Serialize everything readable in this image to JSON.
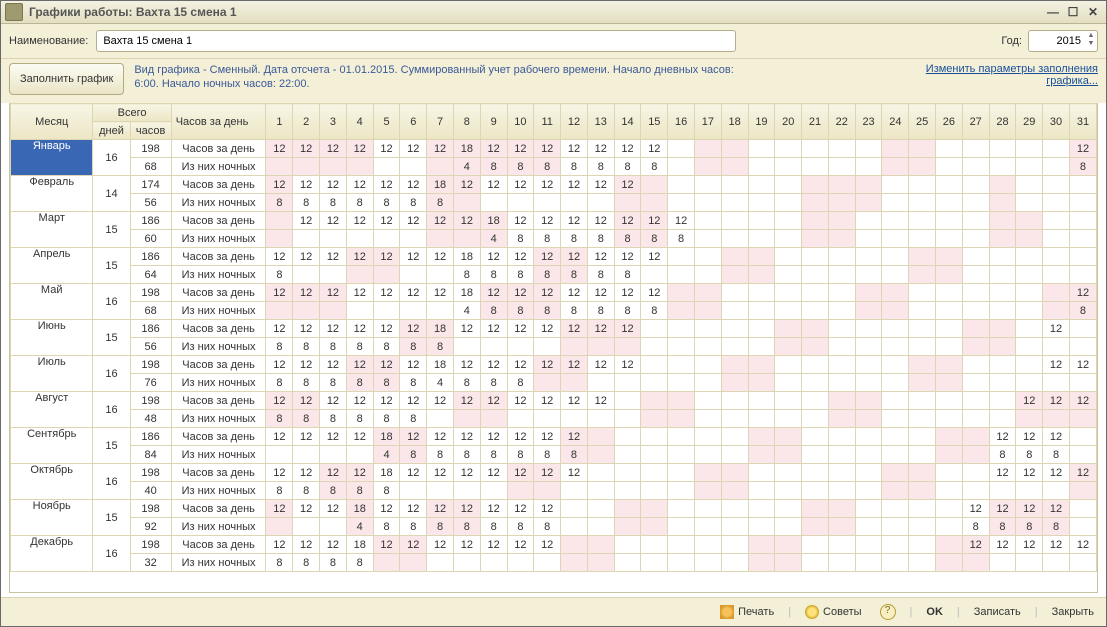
{
  "window": {
    "title": "Графики работы: Вахта 15 смена 1"
  },
  "toolbar": {
    "name_label": "Наименование:",
    "name_value": "Вахта 15 смена 1",
    "year_label": "Год:",
    "year_value": "2015",
    "fill_button": "Заполнить график",
    "description_line1": "Вид графика - Сменный. Дата отсчета - 01.01.2015. Суммированный учет рабочего времени. Начало дневных часов:",
    "description_line2": "6:00. Начало ночных часов: 22:00.",
    "link_line1": "Изменить параметры заполнения",
    "link_line2": "графика..."
  },
  "headers": {
    "month": "Месяц",
    "total": "Всего",
    "days": "дней",
    "hours": "часов",
    "perday": "Часов за день"
  },
  "row_labels": {
    "hours": "Часов за день",
    "night": "Из них ночных"
  },
  "weekend_days": {
    "0": [
      1,
      2,
      3,
      4,
      7,
      8,
      9,
      10,
      11,
      17,
      18,
      24,
      25,
      31
    ],
    "1": [
      1,
      7,
      8,
      14,
      15,
      21,
      22,
      23,
      28
    ],
    "2": [
      1,
      7,
      8,
      9,
      14,
      15,
      21,
      22,
      28,
      29
    ],
    "3": [
      4,
      5,
      11,
      12,
      18,
      19,
      25,
      26
    ],
    "4": [
      1,
      2,
      3,
      9,
      10,
      11,
      16,
      17,
      23,
      24,
      30,
      31
    ],
    "5": [
      6,
      7,
      12,
      13,
      14,
      20,
      21,
      27,
      28
    ],
    "6": [
      4,
      5,
      11,
      12,
      18,
      19,
      25,
      26
    ],
    "7": [
      1,
      2,
      8,
      9,
      15,
      16,
      22,
      23,
      29,
      30,
      31
    ],
    "8": [
      5,
      6,
      12,
      13,
      19,
      20,
      26,
      27
    ],
    "9": [
      3,
      4,
      10,
      11,
      17,
      18,
      24,
      25,
      31
    ],
    "10": [
      1,
      4,
      7,
      8,
      14,
      15,
      21,
      22,
      28,
      29,
      30
    ],
    "11": [
      5,
      6,
      12,
      13,
      19,
      20,
      26,
      27
    ]
  },
  "months": [
    {
      "name": "Январь",
      "selected": true,
      "days": 16,
      "hours": 198,
      "night_total": 68,
      "d": {
        "1": 12,
        "2": 12,
        "3": 12,
        "4": 12,
        "5": 12,
        "6": 12,
        "7": 12,
        "8": 18,
        "9": 12,
        "10": 12,
        "11": 12,
        "12": 12,
        "13": 12,
        "14": 12,
        "15": 12,
        "31": 12
      },
      "n": {
        "8": 4,
        "9": 8,
        "10": 8,
        "11": 8,
        "12": 8,
        "13": 8,
        "14": 8,
        "15": 8,
        "31": 8
      }
    },
    {
      "name": "Февраль",
      "days": 14,
      "hours": 174,
      "night_total": 56,
      "d": {
        "1": 12,
        "2": 12,
        "3": 12,
        "4": 12,
        "5": 12,
        "6": 12,
        "7": 18,
        "8": 12,
        "9": 12,
        "10": 12,
        "11": 12,
        "12": 12,
        "13": 12,
        "14": 12
      },
      "n": {
        "1": 8,
        "2": 8,
        "3": 8,
        "4": 8,
        "5": 8,
        "6": 8,
        "7": 8
      }
    },
    {
      "name": "Март",
      "days": 15,
      "hours": 186,
      "night_total": 60,
      "d": {
        "2": 12,
        "3": 12,
        "4": 12,
        "5": 12,
        "6": 12,
        "7": 12,
        "8": 12,
        "9": 18,
        "10": 12,
        "11": 12,
        "12": 12,
        "13": 12,
        "14": 12,
        "15": 12,
        "16": 12
      },
      "n": {
        "9": 4,
        "10": 8,
        "11": 8,
        "12": 8,
        "13": 8,
        "14": 8,
        "15": 8,
        "16": 8
      }
    },
    {
      "name": "Апрель",
      "days": 15,
      "hours": 186,
      "night_total": 64,
      "d": {
        "1": 12,
        "2": 12,
        "3": 12,
        "4": 12,
        "5": 12,
        "6": 12,
        "7": 12,
        "8": 18,
        "9": 12,
        "10": 12,
        "11": 12,
        "12": 12,
        "13": 12,
        "14": 12,
        "15": 12
      },
      "n": {
        "1": 8,
        "8": 8,
        "9": 8,
        "10": 8,
        "11": 8,
        "12": 8,
        "13": 8,
        "14": 8
      }
    },
    {
      "name": "Май",
      "days": 16,
      "hours": 198,
      "night_total": 68,
      "d": {
        "1": 12,
        "2": 12,
        "3": 12,
        "4": 12,
        "5": 12,
        "6": 12,
        "7": 12,
        "8": 18,
        "9": 12,
        "10": 12,
        "11": 12,
        "12": 12,
        "13": 12,
        "14": 12,
        "15": 12,
        "31": 12
      },
      "n": {
        "8": 4,
        "9": 8,
        "10": 8,
        "11": 8,
        "12": 8,
        "13": 8,
        "14": 8,
        "15": 8,
        "31": 8
      }
    },
    {
      "name": "Июнь",
      "days": 15,
      "hours": 186,
      "night_total": 56,
      "d": {
        "1": 12,
        "2": 12,
        "3": 12,
        "4": 12,
        "5": 12,
        "6": 12,
        "7": 18,
        "8": 12,
        "9": 12,
        "10": 12,
        "11": 12,
        "12": 12,
        "13": 12,
        "14": 12,
        "30": 12
      },
      "n": {
        "1": 8,
        "2": 8,
        "3": 8,
        "4": 8,
        "5": 8,
        "6": 8,
        "7": 8
      }
    },
    {
      "name": "Июль",
      "days": 16,
      "hours": 198,
      "night_total": 76,
      "d": {
        "1": 12,
        "2": 12,
        "3": 12,
        "4": 12,
        "5": 12,
        "6": 12,
        "7": 18,
        "8": 12,
        "9": 12,
        "10": 12,
        "11": 12,
        "12": 12,
        "13": 12,
        "14": 12,
        "30": 12,
        "31": 12
      },
      "n": {
        "1": 8,
        "2": 8,
        "3": 8,
        "4": 8,
        "5": 8,
        "6": 8,
        "7": 4,
        "8": 8,
        "9": 8,
        "10": 8
      }
    },
    {
      "name": "Август",
      "days": 16,
      "hours": 198,
      "night_total": 48,
      "d": {
        "1": 12,
        "2": 12,
        "3": 12,
        "4": 12,
        "5": 12,
        "6": 12,
        "7": 12,
        "8": 12,
        "9": 12,
        "10": 12,
        "11": 12,
        "12": 12,
        "13": 12,
        "29": 12,
        "30": 12,
        "31": 12
      },
      "n": {
        "1": 8,
        "2": 8,
        "3": 8,
        "4": 8,
        "5": 8,
        "6": 8
      }
    },
    {
      "name": "Сентябрь",
      "days": 15,
      "hours": 186,
      "night_total": 84,
      "d": {
        "1": 12,
        "2": 12,
        "3": 12,
        "4": 12,
        "5": 18,
        "6": 12,
        "7": 12,
        "8": 12,
        "9": 12,
        "10": 12,
        "11": 12,
        "12": 12,
        "28": 12,
        "29": 12,
        "30": 12
      },
      "n": {
        "5": 4,
        "6": 8,
        "7": 8,
        "8": 8,
        "9": 8,
        "10": 8,
        "11": 8,
        "12": 8,
        "28": 8,
        "29": 8,
        "30": 8
      }
    },
    {
      "name": "Октябрь",
      "days": 16,
      "hours": 198,
      "night_total": 40,
      "d": {
        "1": 12,
        "2": 12,
        "3": 12,
        "4": 12,
        "5": 18,
        "6": 12,
        "7": 12,
        "8": 12,
        "9": 12,
        "10": 12,
        "11": 12,
        "12": 12,
        "28": 12,
        "29": 12,
        "30": 12,
        "31": 12
      },
      "n": {
        "1": 8,
        "2": 8,
        "3": 8,
        "4": 8,
        "5": 8
      }
    },
    {
      "name": "Ноябрь",
      "days": 15,
      "hours": 198,
      "night_total": 92,
      "d": {
        "1": 12,
        "2": 12,
        "3": 12,
        "4": 18,
        "5": 12,
        "6": 12,
        "7": 12,
        "8": 12,
        "9": 12,
        "10": 12,
        "11": 12,
        "27": 12,
        "28": 12,
        "29": 12,
        "30": 12
      },
      "n": {
        "4": 4,
        "5": 8,
        "6": 8,
        "7": 8,
        "8": 8,
        "9": 8,
        "10": 8,
        "11": 8,
        "27": 8,
        "28": 8,
        "29": 8,
        "30": 8
      }
    },
    {
      "name": "Декабрь",
      "days": 16,
      "hours": 198,
      "night_total": 32,
      "d": {
        "1": 12,
        "2": 12,
        "3": 12,
        "4": 18,
        "5": 12,
        "6": 12,
        "7": 12,
        "8": 12,
        "9": 12,
        "10": 12,
        "11": 12,
        "27": 12,
        "28": 12,
        "29": 12,
        "30": 12,
        "31": 12
      },
      "n": {
        "1": 8,
        "2": 8,
        "3": 8,
        "4": 8
      }
    }
  ],
  "footer": {
    "print": "Печать",
    "tips": "Советы",
    "ok": "OK",
    "save": "Записать",
    "close": "Закрыть"
  }
}
